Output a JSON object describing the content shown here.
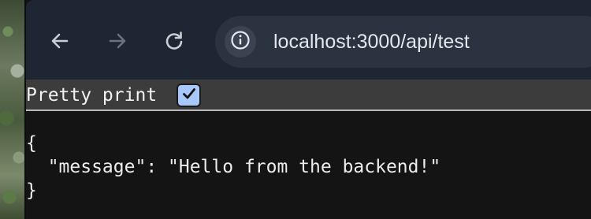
{
  "browser": {
    "url": "localhost:3000/api/test",
    "icons": {
      "back": "arrow-left-icon",
      "forward": "arrow-right-icon",
      "reload": "reload-icon",
      "site_info": "info-icon"
    }
  },
  "page": {
    "pretty_print_label": "Pretty print",
    "pretty_print_checked": true,
    "json_lines": [
      "{",
      "  \"message\": \"Hello from the backend!\"",
      "}"
    ]
  },
  "colors": {
    "toolbar_bg": "#1f2633",
    "omnibox_bg": "#2b3340",
    "page_bg": "#141414",
    "checkbox_accent": "#a8c7fa"
  }
}
